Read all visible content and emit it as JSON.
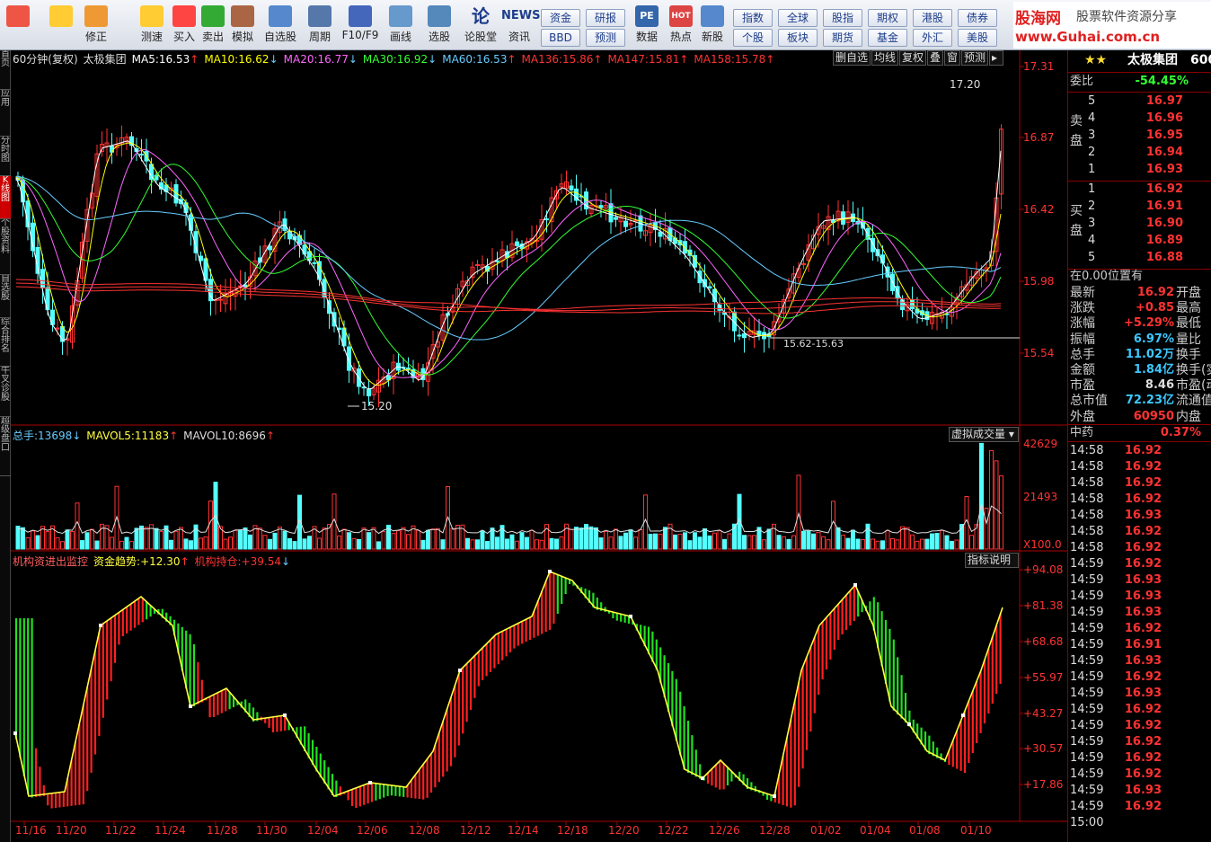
{
  "toolbar": {
    "buttons": [
      {
        "label": "",
        "icon": "windows-icon"
      },
      {
        "label": "",
        "icon": "back-arrow-icon"
      },
      {
        "label": "修正",
        "icon": "fix-icon"
      },
      {
        "label": "测速",
        "icon": "clock-icon"
      },
      {
        "label": "买入",
        "icon": "buy-icon"
      },
      {
        "label": "卖出",
        "icon": "sell-icon"
      },
      {
        "label": "模拟",
        "icon": "hammer-icon"
      },
      {
        "label": "自选股",
        "icon": "star-folder-icon"
      },
      {
        "label": "周期",
        "icon": "period-icon"
      },
      {
        "label": "F10/F9",
        "icon": "f10-icon"
      },
      {
        "label": "画线",
        "icon": "pencil-icon"
      },
      {
        "label": "选股",
        "icon": "select-stock-icon"
      },
      {
        "label": "论股堂",
        "icon": "forum-icon"
      },
      {
        "label": "资讯",
        "icon": "news-icon"
      },
      {
        "label": "数据",
        "icon": "pe-data-icon"
      },
      {
        "label": "热点",
        "icon": "hot-icon"
      },
      {
        "label": "新股",
        "icon": "new-stock-icon"
      }
    ],
    "grid_a": [
      "资金",
      "研报",
      "BBD",
      "预测"
    ],
    "grid_b": [
      "指数",
      "全球",
      "股指",
      "期权",
      "港股",
      "债券",
      "个股",
      "板块",
      "期货",
      "基金",
      "外汇",
      "美股"
    ],
    "news_label": "NEWS",
    "zoom_symbol": "论",
    "pe_text": "PE",
    "hot_text": "HOT"
  },
  "logo": {
    "brand": "股海网",
    "slogan": "股票软件资源分享",
    "url": "www.Guhai.com.cn"
  },
  "left_tabs": [
    "首页",
    "应用",
    "分时图",
    "K线图",
    "个股资料",
    "自选股",
    "综合排名",
    "牛叉诊股",
    "超级盘口"
  ],
  "main": {
    "title_prefix": "60分钟(复权)",
    "stock": "太极集团",
    "ma": [
      {
        "name": "MA5:",
        "value": "16.53",
        "dir": "↑",
        "color": "#ffffff"
      },
      {
        "name": "MA10:",
        "value": "16.62",
        "dir": "↓",
        "color": "#ffff00"
      },
      {
        "name": "MA20:",
        "value": "16.77",
        "dir": "↓",
        "color": "#ff66ff"
      },
      {
        "name": "MA30:",
        "value": "16.92",
        "dir": "↓",
        "color": "#33ff33"
      },
      {
        "name": "MA60:",
        "value": "16.53",
        "dir": "↑",
        "color": "#66ccff"
      },
      {
        "name": "MA136:",
        "value": "15.86",
        "dir": "↑",
        "color": "#ff3333"
      },
      {
        "name": "MA147:",
        "value": "15.81",
        "dir": "↑",
        "color": "#ff3333"
      },
      {
        "name": "MA158:",
        "value": "15.78",
        "dir": "↑",
        "color": "#ff3333"
      }
    ],
    "buttons": [
      "删自选",
      "均线",
      "复权",
      "叠",
      "窗",
      "预测"
    ],
    "price_axis": [
      "17.31",
      "16.87",
      "16.42",
      "15.98",
      "15.54"
    ],
    "annot_high": "17.20",
    "annot_low": "15.20",
    "annot_range": "15.62-15.63"
  },
  "volume": {
    "label": "总手:",
    "value": "13698",
    "dir": "↓",
    "mavol5_label": "MAVOL5:",
    "mavol5": "11183",
    "mavol5_dir": "↑",
    "mavol10_label": "MAVOL10:",
    "mavol10": "8696",
    "mavol10_dir": "↑",
    "axis": [
      "42629",
      "21493",
      "X100.0"
    ],
    "dropdown": "虚拟成交量"
  },
  "indicator": {
    "name": "机构资进出监控",
    "trend_label": "资金趋势:",
    "trend": "+12.30",
    "trend_dir": "↑",
    "hold_label": "机构持仓:",
    "hold": "+39.54",
    "hold_dir": "↓",
    "help": "指标说明",
    "axis": [
      "+94.08",
      "+81.38",
      "+68.68",
      "+55.97",
      "+43.27",
      "+30.57",
      "+17.86"
    ]
  },
  "dates": [
    "11/16",
    "11/20",
    "11/22",
    "11/24",
    "11/28",
    "11/30",
    "12/04",
    "12/06",
    "12/08",
    "12/12",
    "12/14",
    "12/18",
    "12/20",
    "12/22",
    "12/26",
    "12/28",
    "01/02",
    "01/04",
    "01/08",
    "01/10"
  ],
  "panel": {
    "stars": "★★",
    "name": "太极集团",
    "code": "600",
    "weibi_label": "委比",
    "weibi": "-54.45%",
    "sell_label": "卖盘",
    "buy_label": "买盘",
    "sells": [
      {
        "n": "5",
        "p": "16.97"
      },
      {
        "n": "4",
        "p": "16.96"
      },
      {
        "n": "3",
        "p": "16.95"
      },
      {
        "n": "2",
        "p": "16.94"
      },
      {
        "n": "1",
        "p": "16.93"
      }
    ],
    "buys": [
      {
        "n": "1",
        "p": "16.92"
      },
      {
        "n": "2",
        "p": "16.91"
      },
      {
        "n": "3",
        "p": "16.90"
      },
      {
        "n": "4",
        "p": "16.89"
      },
      {
        "n": "5",
        "p": "16.88"
      }
    ],
    "position": "在0.00位置有",
    "stats": [
      {
        "k": "最新",
        "v": "16.92",
        "c": "r",
        "k2": "开盘"
      },
      {
        "k": "涨跌",
        "v": "+0.85",
        "c": "r",
        "k2": "最高"
      },
      {
        "k": "涨幅",
        "v": "+5.29%",
        "c": "r",
        "k2": "最低"
      },
      {
        "k": "振幅",
        "v": "6.97%",
        "c": "c",
        "k2": "量比"
      },
      {
        "k": "总手",
        "v": "11.02万",
        "c": "c",
        "k2": "换手"
      },
      {
        "k": "金额",
        "v": "1.84亿",
        "c": "c",
        "k2": "换手(实"
      },
      {
        "k": "市盈",
        "v": "8.46",
        "c": "w",
        "k2": "市盈(动"
      },
      {
        "k": "总市值",
        "v": "72.23亿",
        "c": "c",
        "k2": "流通值"
      },
      {
        "k": "外盘",
        "v": "60950",
        "c": "r",
        "k2": "内盘"
      }
    ],
    "sector": "中药",
    "sector_pct": "0.37%",
    "ticks": [
      {
        "t": "14:58",
        "p": "16.92",
        "c": "r"
      },
      {
        "t": "14:58",
        "p": "16.92",
        "c": "r"
      },
      {
        "t": "14:58",
        "p": "16.92",
        "c": "r"
      },
      {
        "t": "14:58",
        "p": "16.92",
        "c": "r"
      },
      {
        "t": "14:58",
        "p": "16.93",
        "c": "r"
      },
      {
        "t": "14:58",
        "p": "16.92",
        "c": "r"
      },
      {
        "t": "14:58",
        "p": "16.92",
        "c": "r"
      },
      {
        "t": "14:59",
        "p": "16.92",
        "c": "r"
      },
      {
        "t": "14:59",
        "p": "16.93",
        "c": "r"
      },
      {
        "t": "14:59",
        "p": "16.93",
        "c": "r"
      },
      {
        "t": "14:59",
        "p": "16.93",
        "c": "r"
      },
      {
        "t": "14:59",
        "p": "16.92",
        "c": "r"
      },
      {
        "t": "14:59",
        "p": "16.91",
        "c": "r"
      },
      {
        "t": "14:59",
        "p": "16.93",
        "c": "r"
      },
      {
        "t": "14:59",
        "p": "16.92",
        "c": "r"
      },
      {
        "t": "14:59",
        "p": "16.93",
        "c": "r"
      },
      {
        "t": "14:59",
        "p": "16.92",
        "c": "r"
      },
      {
        "t": "14:59",
        "p": "16.92",
        "c": "r"
      },
      {
        "t": "14:59",
        "p": "16.92",
        "c": "r"
      },
      {
        "t": "14:59",
        "p": "16.92",
        "c": "r"
      },
      {
        "t": "14:59",
        "p": "16.92",
        "c": "r"
      },
      {
        "t": "14:59",
        "p": "16.93",
        "c": "r"
      },
      {
        "t": "14:59",
        "p": "16.92",
        "c": "r"
      },
      {
        "t": "15:00",
        "p": "",
        "c": "r"
      }
    ]
  }
}
